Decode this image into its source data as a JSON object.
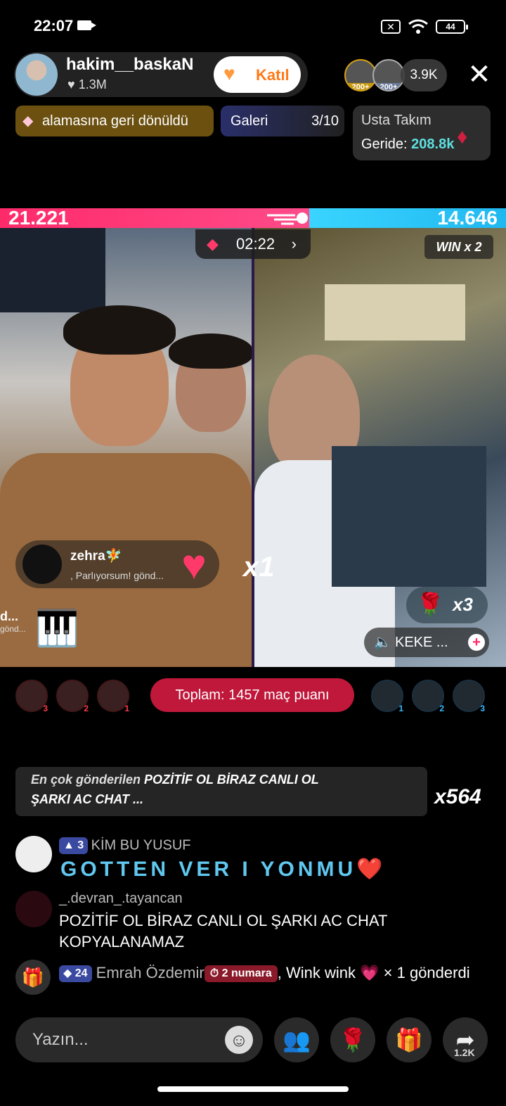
{
  "status": {
    "time": "22:07",
    "battery": "44"
  },
  "host": {
    "name": "hakim__baskaN",
    "likes": "1.3M",
    "join_label": "Katıl"
  },
  "viewers": {
    "badge1": "200+",
    "badge2": "200+",
    "count": "3.9K"
  },
  "chips": {
    "rank_text": "alamasına geri dönüldü",
    "gallery_label": "Galeri",
    "gallery_count": "3/10",
    "team_title": "Usta Takım",
    "team_behind_label": "Geride:",
    "team_behind_value": "208.8k"
  },
  "battle": {
    "score_left": "21.221",
    "score_right": "14.646",
    "timer": "02:22",
    "win_label": "WIN x 2",
    "gift_user": "zehra🧚",
    "gift_sub": ", Parlıyorsum!  gönd...",
    "gift_multiplier": "x1",
    "left_clip_name": "d...",
    "left_clip_sub": "gönd...",
    "rose_multiplier": "x3",
    "opponent_name": "KEKE ...",
    "total_points": "Toplam: 1457 maç puanı",
    "supporters_left": [
      "3",
      "2",
      "1"
    ],
    "supporters_right": [
      "1",
      "2",
      "3"
    ]
  },
  "chat": {
    "banner_prefix": "En çok gönderilen",
    "banner_gift": "POZİTİF OL BİRAZ CANLI OL",
    "banner_line2": "ŞARKI AC CHAT ...",
    "banner_multiplier": "x564",
    "msg1_level": "3",
    "msg1_user": "KİM BU YUSUF",
    "msg1_text": "GOTTEN VER I YONMU❤️",
    "msg2_user": "_.devran_.tayancan",
    "msg2_text": "POZİTİF OL BİRAZ CANLI OL ŞARKI AC CHAT KOPYALANAMAZ",
    "msg3_level": "24",
    "msg3_user": "Emrah Özdemir",
    "msg3_rank": "2 numara",
    "msg3_text": ", Wink wink 💗 × 1 gönderdi"
  },
  "bottom": {
    "placeholder": "Yazın...",
    "share_count": "1.2K"
  },
  "colors": {
    "red_team": "#ff2a6a",
    "blue_team": "#3ad4ff",
    "accent": "#c0183a"
  }
}
